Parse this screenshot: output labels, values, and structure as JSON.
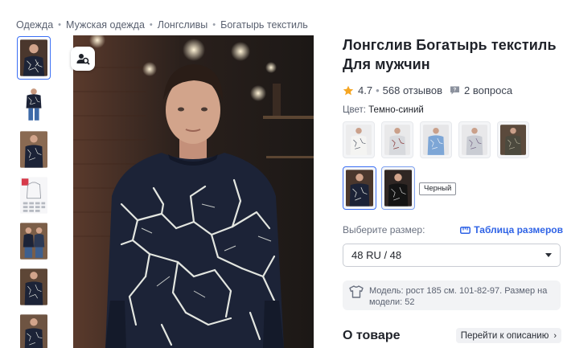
{
  "breadcrumb": [
    "Одежда",
    "Мужская одежда",
    "Лонгсливы",
    "Богатырь текстиль"
  ],
  "product": {
    "title": "Лонгслив Богатырь текстиль Для мужчин",
    "rating": "4.7",
    "reviews": "568 отзывов",
    "questions": "2 вопроса",
    "color_label": "Цвет:",
    "color_value": "Темно-синий"
  },
  "tooltip": "Черный",
  "size": {
    "label": "Выберите размер:",
    "table_link": "Таблица размеров",
    "selected": "48 RU / 48"
  },
  "model_info": "Модель: рост 185 см. 101-82-97. Размер на модели: 52",
  "about": {
    "title": "О товаре",
    "link": "Перейти к описанию"
  },
  "colors": {
    "accent": "#3b6ff5",
    "link": "#2f63e6",
    "star": "#f5a623",
    "shirt_navy": "#1c2337",
    "crack": "#e3e6e0"
  },
  "icons": {
    "zoom": "search-person-icon",
    "star": "star-icon",
    "questions": "speech-bubble-icon",
    "size_table": "ruler-icon",
    "model": "tshirt-icon",
    "dropdown": "caret-down-icon",
    "about": "chevron-right-icon"
  }
}
